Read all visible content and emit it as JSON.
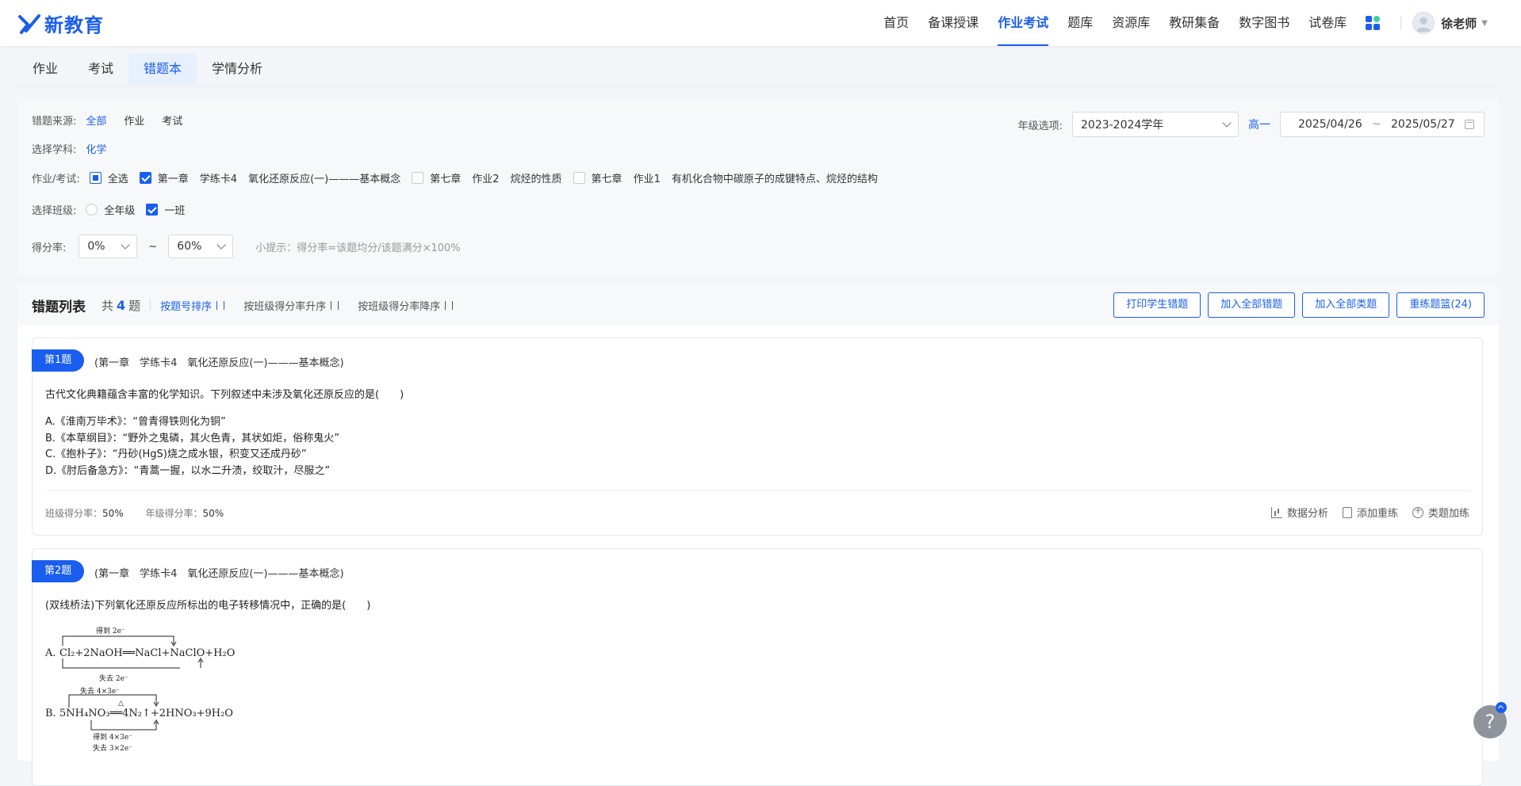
{
  "brand": {
    "name": "新教育"
  },
  "nav": {
    "items": [
      {
        "label": "首页"
      },
      {
        "label": "备课授课"
      },
      {
        "label": "作业考试"
      },
      {
        "label": "题库"
      },
      {
        "label": "资源库"
      },
      {
        "label": "教研集备"
      },
      {
        "label": "数字图书"
      },
      {
        "label": "试卷库"
      }
    ],
    "active_index": 2,
    "user": "徐老师",
    "accent": "#1a5ef0"
  },
  "subtabs": [
    {
      "label": "作业"
    },
    {
      "label": "考试"
    },
    {
      "label": "错题本"
    },
    {
      "label": "学情分析"
    }
  ],
  "filters": {
    "source": {
      "label": "错题来源:",
      "options": [
        "全部",
        "作业",
        "考试"
      ],
      "selected": "全部"
    },
    "subject": {
      "label": "选择学科:",
      "value": "化学"
    },
    "work": {
      "label": "作业/考试:",
      "select_all": "全选",
      "items": [
        {
          "chapter": "第一章",
          "name": "学练卡4",
          "title": "氧化还原反应(一)———基本概念",
          "checked": true
        },
        {
          "chapter": "第七章",
          "name": "作业2",
          "title": "烷烃的性质",
          "checked": false
        },
        {
          "chapter": "第七章",
          "name": "作业1",
          "title": "有机化合物中碳原子的成键特点、烷烃的结构",
          "checked": false
        }
      ]
    },
    "class": {
      "label": "选择班级:",
      "all": "全年级",
      "class1": "一班"
    },
    "score": {
      "label": "得分率:",
      "min": "0%",
      "sep": "~",
      "max": "60%",
      "hint": "小提示：得分率=该题均分/该题满分×100%"
    },
    "grade": {
      "label": "年级选项:",
      "year": "2023-2024学年",
      "level": "高一",
      "start": "2025/04/26",
      "tilde": "~",
      "end": "2025/05/27"
    }
  },
  "list": {
    "title": "错题列表",
    "count_prefix": "共",
    "count": "4",
    "count_suffix": "题",
    "sorts": [
      "按题号排序",
      "按班级得分率升序",
      "按班级得分率降序"
    ],
    "buttons": [
      "打印学生错题",
      "加入全部错题",
      "加入全部类题",
      "重练题篮(24)"
    ]
  },
  "questions": [
    {
      "badge": "第1题",
      "source": "(第一章　学练卡4　氧化还原反应(一)———基本概念)",
      "stem": "古代文化典籍蕴含丰富的化学知识。下列叙述中未涉及氧化还原反应的是(　　)",
      "options": [
        "A.《淮南万毕术》：“曾青得铁则化为铜”",
        "B.《本草纲目》：“野外之鬼磷，其火色青，其状如炬，俗称鬼火”",
        "C.《抱朴子》：“丹砂(HgS)烧之成水银，积变又还成丹砂”",
        "D.《肘后备急方》：“青蒿一握，以水二升渍，绞取汁，尽服之”"
      ],
      "class_rate_label": "班级得分率：",
      "class_rate": "50%",
      "grade_rate_label": "年级得分率：",
      "grade_rate": "50%",
      "actions": [
        "数据分析",
        "添加重练",
        "类题加练"
      ]
    },
    {
      "badge": "第2题",
      "source": "(第一章　学练卡4　氧化还原反应(一)———基本概念)",
      "stem": "(双线桥法)下列氧化还原反应所标出的电子转移情况中，正确的是(　　)",
      "eqA": {
        "label": "A.",
        "top": "得到 2e⁻",
        "formula": "Cl₂+2NaOH══NaCl+NaClO+H₂O",
        "bottom": "失去 2e⁻"
      },
      "eqB": {
        "label": "B.",
        "top": "失去 4×3e⁻",
        "formula": "5NH₄NO₃══4N₂↑+2HNO₃+9H₂O",
        "cond": "△",
        "bottom": "得到 4×3e⁻",
        "bottom2": "失去 3×2e⁻"
      }
    }
  ]
}
